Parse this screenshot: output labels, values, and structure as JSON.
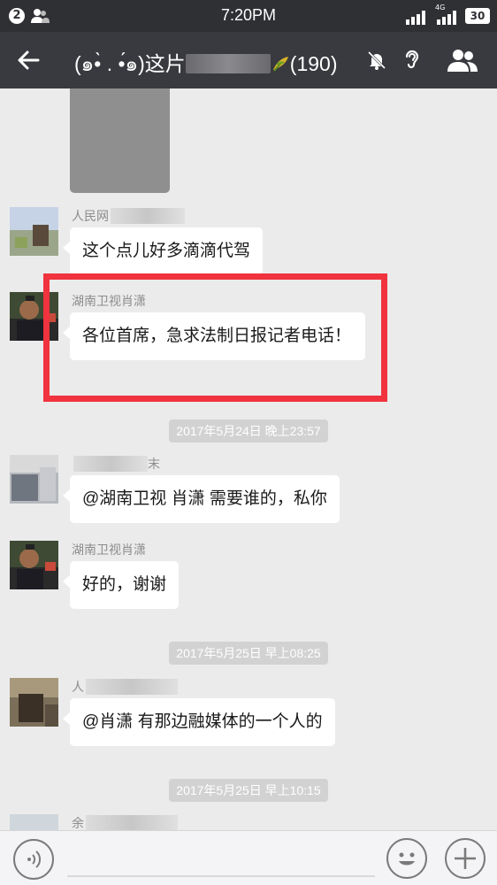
{
  "status_bar": {
    "notification_count": "2",
    "time": "7:20PM",
    "network": "4G",
    "battery": "30"
  },
  "title_bar": {
    "title_prefix": "(๑•̀ . •́๑)这片",
    "member_count": "(190)"
  },
  "messages": [
    {
      "sender": "人民网",
      "text": "这个点儿好多滴滴代驾"
    },
    {
      "sender": "湖南卫视肖潇",
      "text": "各位首席，急求法制日报记者电话！"
    },
    {
      "sender": "末",
      "text": "@湖南卫视 肖潇  需要谁的，私你"
    },
    {
      "sender": "湖南卫视肖潇",
      "text": "好的，谢谢"
    },
    {
      "sender": "人",
      "text": "@肖潇 有那边融媒体的一个人的"
    },
    {
      "sender": "余"
    }
  ],
  "timestamps": [
    "2017年5月24日 晚上23:57",
    "2017年5月25日 早上08:25",
    "2017年5月25日 早上10:15"
  ],
  "colors": {
    "status_bar": "#2f3034",
    "title_bar": "#393a3f",
    "chat_bg": "#ebebeb",
    "highlight": "#f0333e"
  }
}
